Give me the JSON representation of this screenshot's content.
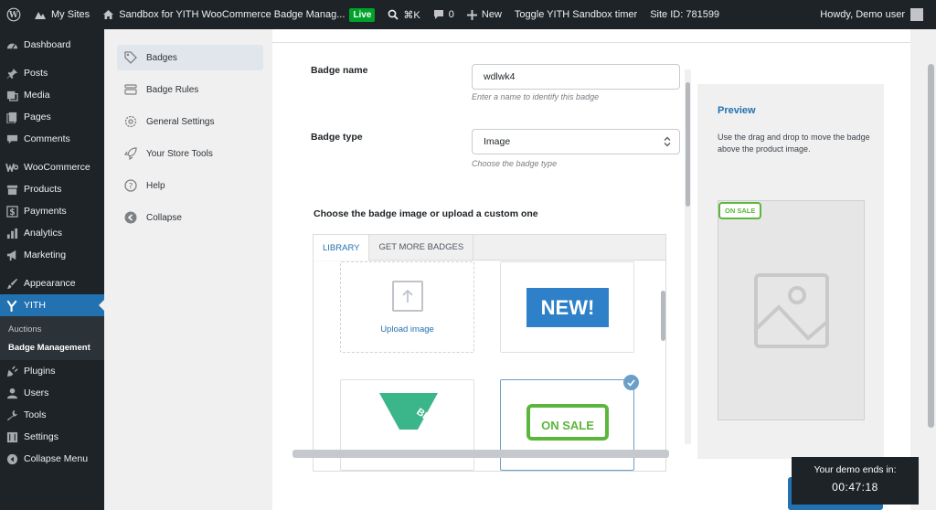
{
  "admin_bar": {
    "my_sites": "My Sites",
    "site_name": "Sandbox for YITH WooCommerce Badge Manag...",
    "live": "Live",
    "shortcut": "⌘K",
    "comments_count": "0",
    "new": "New",
    "toggle_timer": "Toggle YITH Sandbox timer",
    "site_id": "Site ID: 781599",
    "howdy": "Howdy, Demo user"
  },
  "admin_menu": {
    "items": [
      {
        "label": "Dashboard",
        "icon": "dashboard-icon"
      },
      {
        "label": "Posts",
        "icon": "pin-icon"
      },
      {
        "label": "Media",
        "icon": "media-icon"
      },
      {
        "label": "Pages",
        "icon": "pages-icon"
      },
      {
        "label": "Comments",
        "icon": "comment-icon"
      },
      {
        "label": "WooCommerce",
        "icon": "woo-icon"
      },
      {
        "label": "Products",
        "icon": "archive-icon"
      },
      {
        "label": "Payments",
        "icon": "dollar-icon"
      },
      {
        "label": "Analytics",
        "icon": "bar-chart-icon"
      },
      {
        "label": "Marketing",
        "icon": "megaphone-icon"
      },
      {
        "label": "Appearance",
        "icon": "brush-icon"
      },
      {
        "label": "YITH",
        "icon": "yith-icon"
      }
    ],
    "submenu": [
      "Auctions",
      "Badge Management"
    ],
    "items_after": [
      {
        "label": "Plugins",
        "icon": "plugin-icon"
      },
      {
        "label": "Users",
        "icon": "user-icon"
      },
      {
        "label": "Tools",
        "icon": "wrench-icon"
      },
      {
        "label": "Settings",
        "icon": "settings-icon"
      },
      {
        "label": "Collapse Menu",
        "icon": "collapse-icon"
      }
    ]
  },
  "plugin_nav": {
    "badges": "Badges",
    "badge_rules": "Badge Rules",
    "general_settings": "General Settings",
    "store_tools": "Your Store Tools",
    "help": "Help",
    "collapse": "Collapse"
  },
  "form": {
    "badge_name_label": "Badge name",
    "badge_name_value": "wdlwk4",
    "badge_name_help": "Enter a name to identify this badge",
    "badge_type_label": "Badge type",
    "badge_type_value": "Image",
    "badge_type_help": "Choose the badge type",
    "image_section_title": "Choose the badge image or upload a custom one"
  },
  "library": {
    "tabs": [
      "LIBRARY",
      "GET MORE BADGES"
    ],
    "upload_label": "Upload image",
    "new_badge_text": "NEW!",
    "best_badge_text": "BEST",
    "onsale_badge_text": "ON SALE"
  },
  "preview": {
    "title": "Preview",
    "description": "Use the drag and drop to move the badge above the product image.",
    "badge_text": "ON SALE"
  },
  "demo_timer": {
    "label": "Your demo ends in:",
    "time": "00:47:18"
  },
  "colors": {
    "admin_dark": "#1d2327",
    "accent": "#2271b1",
    "live_green": "#00a32a",
    "onsale_green": "#5bb73b",
    "new_badge_blue": "#2e80c8",
    "best_badge_teal": "#3bb58a"
  }
}
